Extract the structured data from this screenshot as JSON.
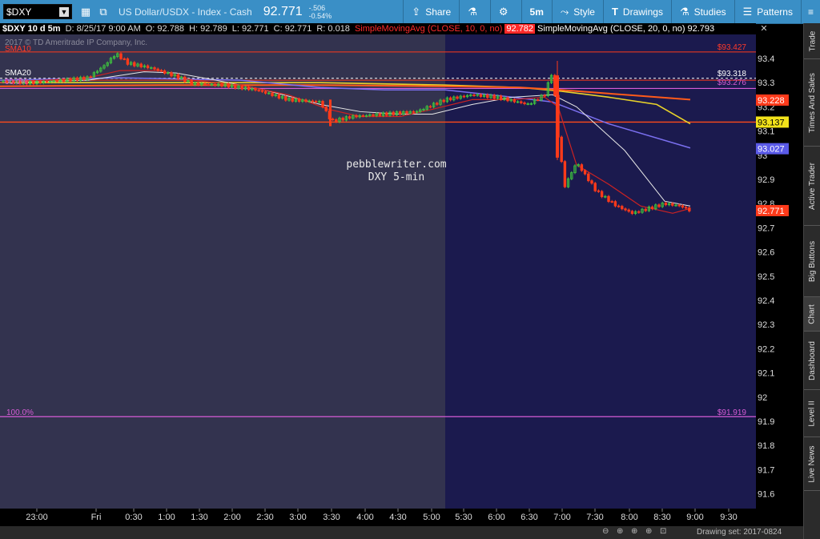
{
  "toolbar": {
    "symbol": "$DXY",
    "title": "US Dollar/USDX - Index - Cash",
    "price": "92.771",
    "change": "-.506",
    "change_pct": "-0.54%",
    "share_label": "Share",
    "timeframe_label": "5m",
    "style_label": "Style",
    "drawings_label": "Drawings",
    "studies_label": "Studies",
    "patterns_label": "Patterns"
  },
  "infobar": {
    "symbol_period": "$DXY 10 d 5m",
    "date": "D: 8/25/17 9:00 AM",
    "open": "O: 92.788",
    "high": "H: 92.789",
    "low": "L: 92.771",
    "close": "C: 92.771",
    "range": "R: 0.018",
    "sma10_label": "SimpleMovingAvg (CLOSE, 10, 0, no)",
    "sma10_value": "92.782",
    "sma20_label": "SimpleMovingAvg (CLOSE, 20, 0, no)",
    "sma20_value": "92.793"
  },
  "chart": {
    "copyright": "2017 © TD Ameritrade IP Company, Inc.",
    "label_sma10": "SMA10",
    "label_sma20": "SMA20",
    "label_fib_top": "00.0%",
    "label_fib_bottom": "100.0%",
    "watermark_line1": "pebblewriter.com",
    "watermark_line2": "DXY 5-min",
    "line_label_93427": "$93.427",
    "line_label_93318": "$93.318",
    "line_label_93276": "$93.276",
    "line_label_91919": "$91.919",
    "tag_93228": "93.228",
    "tag_93137": "93.137",
    "tag_93027": "93.027",
    "tag_92771": "92.771",
    "colors": {
      "background_premarket": "#33334f",
      "background_session": "#1b1a4e",
      "up": "#3ec43e",
      "down": "#ff3a1a",
      "sma10": "#cc2222",
      "sma20": "#e8e8e8",
      "sma_yellow": "#e8d22a",
      "sma_orange": "#ff5a1a",
      "sma_blue": "#7b70f0",
      "fib": "#d65cd6"
    }
  },
  "chart_data": {
    "type": "candlestick",
    "x_tick_labels": [
      "23:00",
      "Fri",
      "0:30",
      "1:00",
      "1:30",
      "2:00",
      "2:30",
      "3:00",
      "3:30",
      "4:00",
      "4:30",
      "5:00",
      "5:30",
      "6:00",
      "6:30",
      "7:00",
      "7:30",
      "8:00",
      "8:30",
      "9:00",
      "9:30"
    ],
    "y_tick_labels": [
      "93.4",
      "93.3",
      "93.2",
      "93.1",
      "93",
      "92.9",
      "92.8",
      "92.7",
      "92.6",
      "92.5",
      "92.4",
      "92.3",
      "92.2",
      "92.1",
      "92",
      "91.9",
      "91.8",
      "91.7",
      "91.6"
    ],
    "ylim": [
      91.56,
      93.46
    ],
    "horizontal_lines": [
      93.427,
      93.318,
      93.276,
      93.137,
      91.919
    ],
    "last": 92.771
  },
  "bottom": {
    "drawing_set": "Drawing set: 2017-0824"
  },
  "sidebar": {
    "tabs": [
      "Trade",
      "Times And Sales",
      "Active Trader",
      "Big Buttons",
      "Chart",
      "Dashboard",
      "Level II",
      "Live News"
    ]
  }
}
